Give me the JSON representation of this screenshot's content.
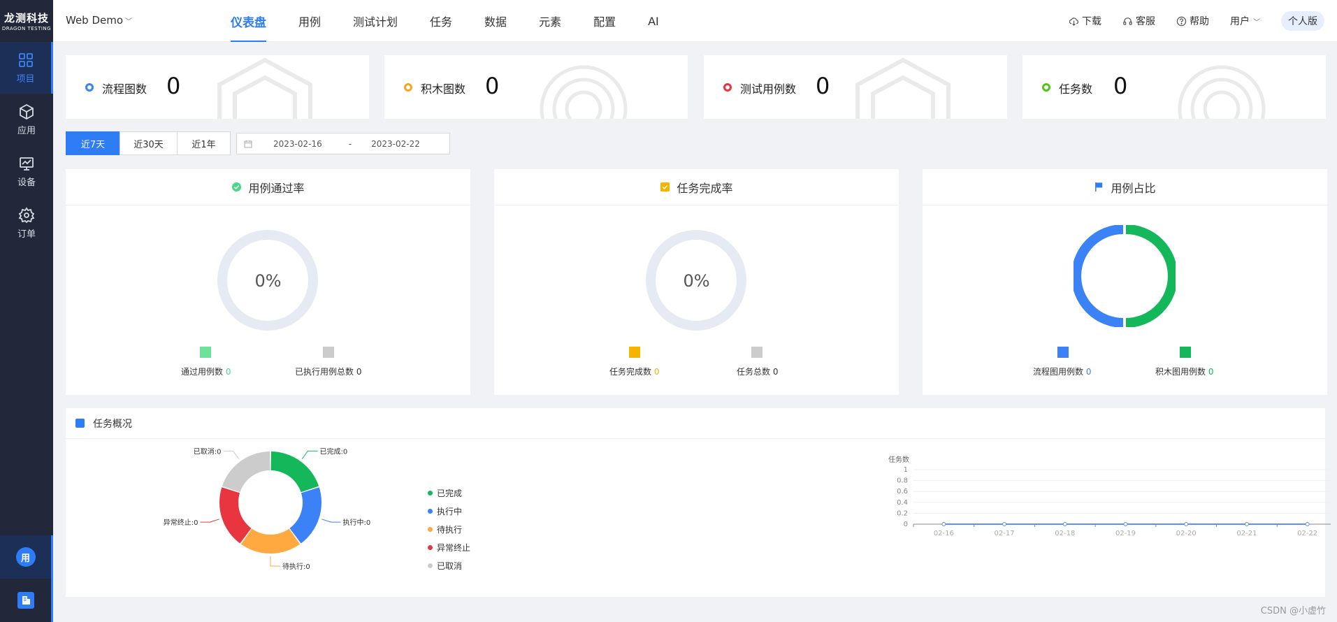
{
  "app": {
    "logo_cn": "龙测科技",
    "logo_en": "DRAGON TESTING",
    "project": "Web Demo"
  },
  "sidebar": {
    "items": [
      {
        "label": "项目",
        "icon": "grid-icon",
        "active": true
      },
      {
        "label": "应用",
        "icon": "cube-icon",
        "active": false
      },
      {
        "label": "设备",
        "icon": "monitor-icon",
        "active": false
      },
      {
        "label": "订单",
        "icon": "gear-icon",
        "active": false
      }
    ],
    "user_badge": "用"
  },
  "header": {
    "tabs": [
      {
        "label": "仪表盘",
        "active": true
      },
      {
        "label": "用例"
      },
      {
        "label": "测试计划"
      },
      {
        "label": "任务"
      },
      {
        "label": "数据"
      },
      {
        "label": "元素"
      },
      {
        "label": "配置"
      },
      {
        "label": "AI"
      }
    ],
    "download": "下载",
    "service": "客服",
    "help": "帮助",
    "user": "用户",
    "edition": "个人版"
  },
  "stats": [
    {
      "label": "流程图数",
      "value": "0",
      "color": "#3b82f6"
    },
    {
      "label": "积木图数",
      "value": "0",
      "color": "#f5a623"
    },
    {
      "label": "测试用例数",
      "value": "0",
      "color": "#e8353f"
    },
    {
      "label": "任务数",
      "value": "0",
      "color": "#52c41a"
    }
  ],
  "date_filter": {
    "ranges": [
      "近7天",
      "近30天",
      "近1年"
    ],
    "active": "近7天",
    "start": "2023-02-16",
    "separator": "-",
    "end": "2023-02-22"
  },
  "panels": {
    "pass_rate": {
      "title": "用例通过率",
      "value": "0%",
      "legend": [
        {
          "label": "通过用例数",
          "value": "0",
          "color": "#6ee29a"
        },
        {
          "label": "已执行用例总数",
          "value": "0",
          "color": "#cccccc"
        }
      ]
    },
    "task_rate": {
      "title": "任务完成率",
      "value": "0%",
      "legend": [
        {
          "label": "任务完成数",
          "value": "0",
          "color": "#f5b400"
        },
        {
          "label": "任务总数",
          "value": "0",
          "color": "#cccccc"
        }
      ]
    },
    "case_ratio": {
      "title": "用例占比",
      "legend": [
        {
          "label": "流程图用例数",
          "value": "0",
          "color": "#3b82f6"
        },
        {
          "label": "积木图用例数",
          "value": "0",
          "color": "#14b85a"
        }
      ]
    }
  },
  "overview": {
    "title": "任务概况",
    "legend": [
      {
        "label": "已完成",
        "color": "#14b85a"
      },
      {
        "label": "执行中",
        "color": "#3b82f6"
      },
      {
        "label": "待执行",
        "color": "#ffa940"
      },
      {
        "label": "异常终止",
        "color": "#e8353f"
      },
      {
        "label": "已取消",
        "color": "#cccccc"
      }
    ]
  },
  "chart_data": [
    {
      "type": "pie",
      "title": "",
      "categories": [
        "已完成",
        "执行中",
        "待执行",
        "异常终止",
        "已取消"
      ],
      "values": [
        0,
        0,
        0,
        0,
        0
      ],
      "labels": [
        "已完成:0",
        "执行中:0",
        "待执行:0",
        "异常终止:0",
        "已取消:0"
      ],
      "colors": [
        "#14b85a",
        "#3b82f6",
        "#ffa940",
        "#e8353f",
        "#cccccc"
      ]
    },
    {
      "type": "line",
      "title": "",
      "ylabel": "任务数",
      "xlabel": "",
      "x": [
        "02-16",
        "02-17",
        "02-18",
        "02-19",
        "02-20",
        "02-21",
        "02-22"
      ],
      "series": [
        {
          "values": [
            0,
            0,
            0,
            0,
            0,
            0,
            0
          ],
          "color": "#5b8ff9"
        }
      ],
      "ylim": [
        0,
        1
      ],
      "yticks": [
        "0",
        "0.2",
        "0.4",
        "0.6",
        "0.8",
        "1"
      ],
      "grid": true
    }
  ],
  "watermark": "CSDN @小虚竹"
}
